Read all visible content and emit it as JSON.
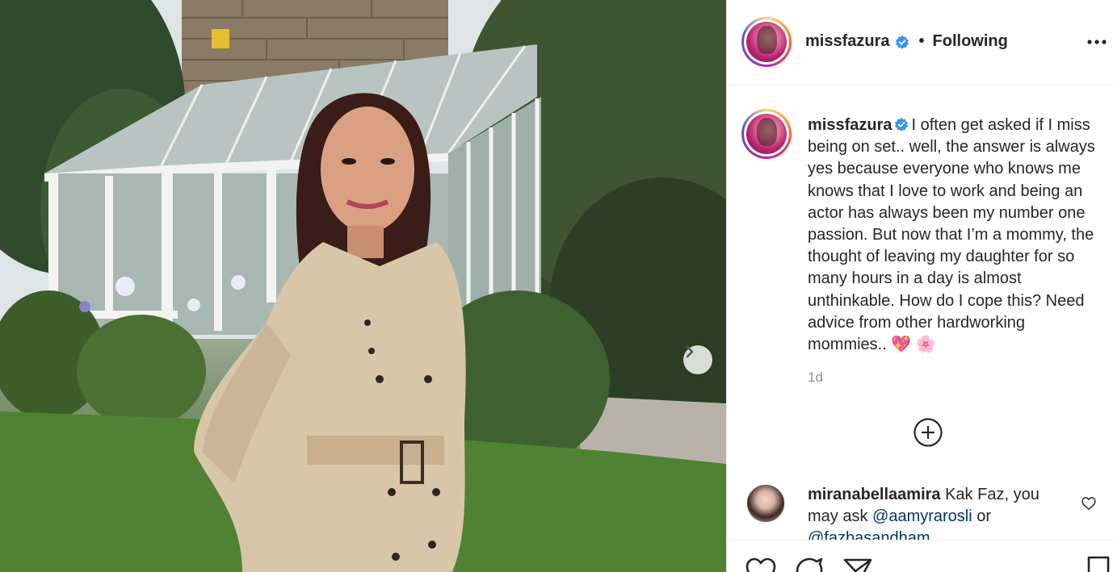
{
  "post": {
    "username": "missfazura",
    "follow_status": "Following",
    "separator": "•"
  },
  "caption": {
    "username": "missfazura",
    "text": "I often get asked if I miss being on set.. well, the answer is always yes because everyone who knows me knows that I love to work and being an actor has always been my number one passion. But now that I’m a mommy, the thought of leaving my daughter for so many hours in a day is almost unthinkable. How do I cope this? Need advice from other hardworking mommies.. 💖 🌸",
    "time": "1d"
  },
  "comment": {
    "username": "miranabellaamira",
    "text_before": "Kak Faz, you may ask",
    "mention_1": "@aamyrarosli",
    "text_mid": "or",
    "mention_2": "@fazbasandham"
  },
  "icons": {
    "verified": "verified-badge-icon",
    "more": "more-options-icon",
    "next": "chevron-right-icon",
    "add": "plus-circle-icon",
    "like": "heart-icon",
    "comment": "comment-icon",
    "share": "paper-plane-icon",
    "save": "bookmark-icon"
  },
  "colors": {
    "verified": "#3897f0",
    "mention": "#00376b",
    "timestamp": "#8e8e8e"
  }
}
